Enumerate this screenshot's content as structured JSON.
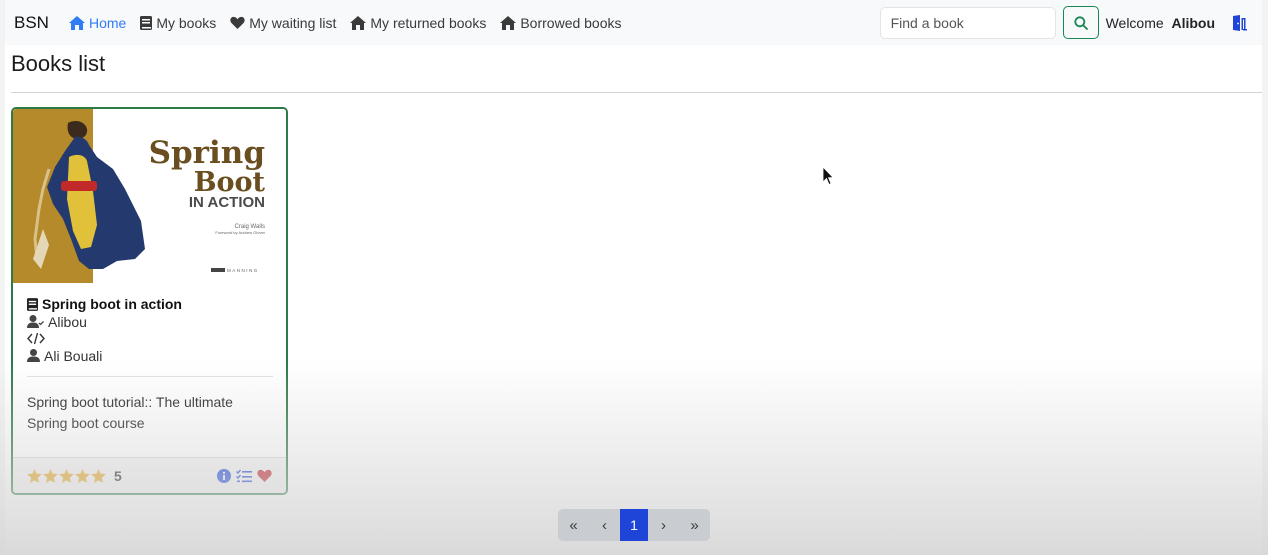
{
  "navbar": {
    "brand": "BSN",
    "links": [
      {
        "label": "Home",
        "icon": "home-icon",
        "active": true
      },
      {
        "label": "My books",
        "icon": "book-icon"
      },
      {
        "label": "My waiting list",
        "icon": "heart-icon"
      },
      {
        "label": "My returned books",
        "icon": "home-icon"
      },
      {
        "label": "Borrowed books",
        "icon": "home-icon"
      }
    ],
    "search": {
      "placeholder": "Find a book"
    },
    "welcome_prefix": "Welcome",
    "user_name": "Alibou",
    "logout_icon": "door-open-icon"
  },
  "page": {
    "title": "Books list"
  },
  "books": [
    {
      "title": "Spring boot in action",
      "owner": "Alibou",
      "isbn": "",
      "author": "Ali Bouali",
      "synopsis": "Spring boot tutorial:: The ultimate Spring boot course",
      "rating": 5,
      "cover": {
        "title_line1": "Spring",
        "title_line2": "Boot",
        "subtitle": "IN ACTION",
        "author": "Craig Walls",
        "foreword": "Foreword by Andrew Glover",
        "publisher": "MANNING"
      }
    }
  ],
  "pagination": {
    "first": "«",
    "prev": "‹",
    "current": "1",
    "next": "›",
    "last": "»"
  },
  "colors": {
    "accent": "#2f7df6",
    "card_border": "#2c7a45",
    "star": "#e2a521",
    "info": "#1f45d8",
    "heart": "#c0202e",
    "cover_band": "#b48a2a",
    "cover_title": "#6b4e20"
  }
}
